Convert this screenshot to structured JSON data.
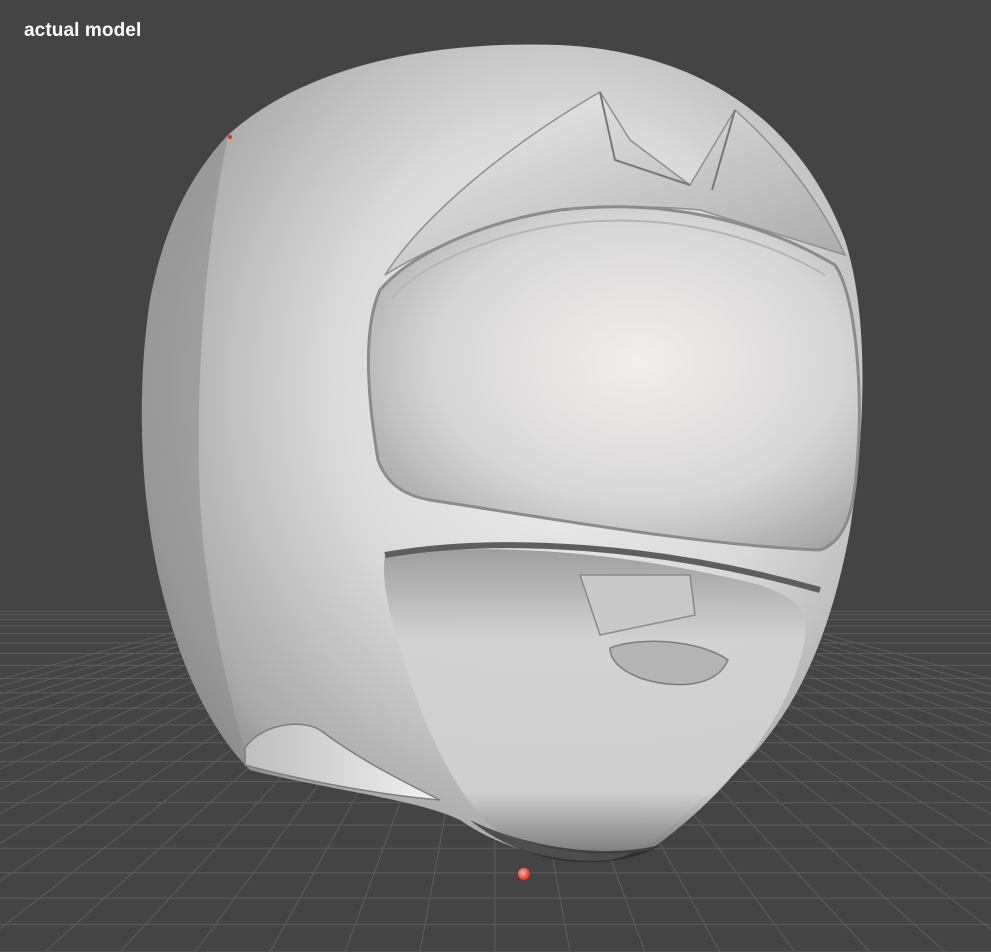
{
  "viewport": {
    "label": "actual model",
    "background_color": "#444444",
    "grid_color": "#5a5a5a",
    "model_color": "#d8d8d8",
    "pivot_color": "#ff3b2f"
  },
  "scene": {
    "grid": "visible",
    "model": "helmet-mesh",
    "pivot_marker": "visible"
  }
}
